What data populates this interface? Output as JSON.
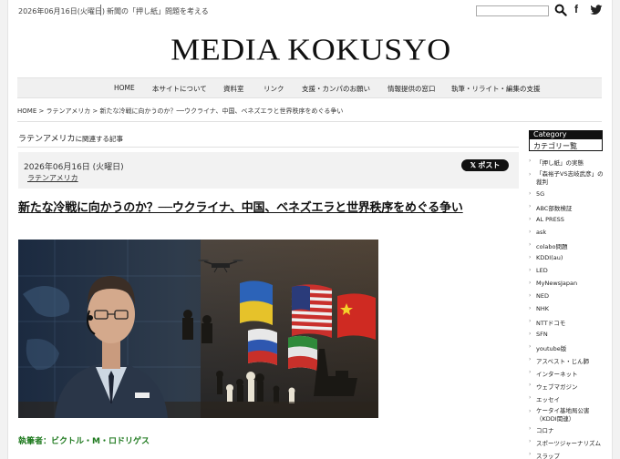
{
  "header": {
    "date": "2026年06月16日(火曜日)",
    "tagline": "新聞の「押し紙」問題を考える",
    "search_placeholder": "",
    "social": {
      "facebook": "f",
      "twitter": "twitter-bird-icon"
    }
  },
  "site": {
    "logo": "MEDIA KOKUSYO"
  },
  "nav": [
    "HOME",
    "本サイトについて",
    "資料室",
    "リンク",
    "支援・カンパのお願い",
    "情報提供の窓口",
    "執筆・リライト・編集の支援"
  ],
  "breadcrumb": "HOME > ラテンアメリカ > 新たな冷戦に向かうのか？──ウクライナ、中国、ベネズエラと世界秩序をめぐる争い",
  "archive": {
    "category": "ラテンアメリカ",
    "suffix": "に関連する記事"
  },
  "article": {
    "date": "2026年06月16日 (火曜日)",
    "category": "ラテンアメリカ",
    "share_label": "𝕏 ポスト",
    "title": "新たな冷戦に向かうのか？──ウクライナ、中国、ベネズエラと世界秩序をめぐる争い",
    "author": "執筆者：ビクトル・M・ロドリゲス"
  },
  "sidebar": {
    "heading_en": "Category",
    "heading_ja": "カテゴリー覧",
    "items": [
      "「押し紙」の実態",
      "「森裕子VS志岐武彦」の裁判",
      "5G",
      "ABC部数検証",
      "AL PRESS",
      "ask",
      "colabo問題",
      "KDDI(au)",
      "LED",
      "MyNewsJapan",
      "NED",
      "NHK",
      "NTTドコモ",
      "SFN",
      "youtube版",
      "アスベスト・じん肺",
      "インターネット",
      "ウェブマガジン",
      "エッセイ",
      "ケータイ基地局公害（KDDI関連）",
      "コロナ",
      "スポーツジャーナリズム",
      "スラップ"
    ]
  },
  "colors": {
    "author": "#1f7a1f",
    "nav_bg": "#f0f0f0",
    "sidebar_head": "#111111"
  }
}
